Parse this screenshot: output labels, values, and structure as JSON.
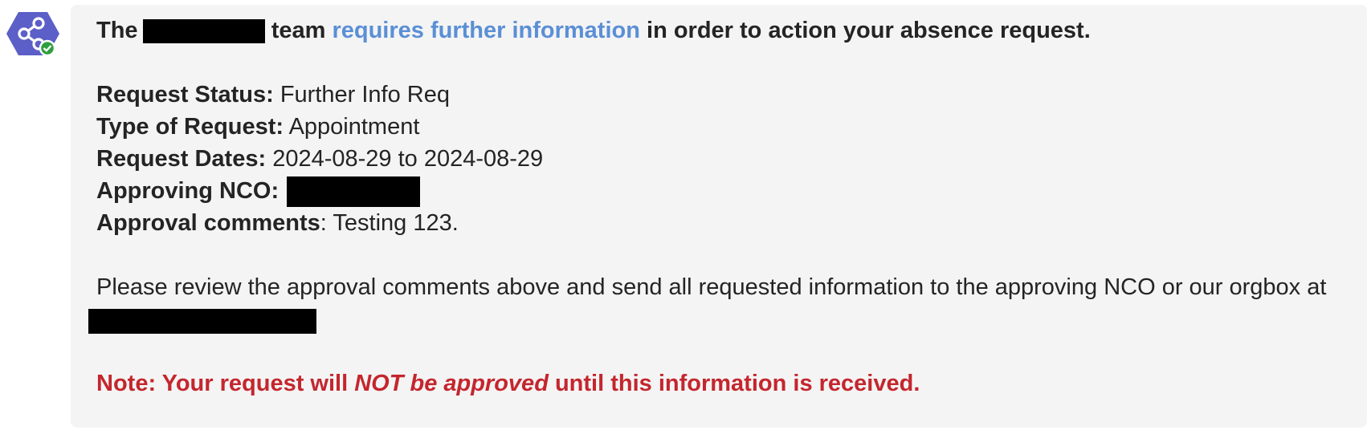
{
  "message": {
    "intro_before": "The",
    "intro_after": "team",
    "intro_link": "requires further information",
    "intro_end": "in order to action your absence request.",
    "fields": {
      "status_label": "Request Status:",
      "status_value": "Further Info Req",
      "type_label": "Type of Request:",
      "type_value": "Appointment",
      "dates_label": "Request Dates:",
      "dates_value": "2024-08-29 to 2024-08-29",
      "nco_label": "Approving NCO:",
      "comments_label": "Approval comments",
      "comments_value": ": Testing 123."
    },
    "instruction": "Please review the approval comments above and send all requested information to the approving NCO or our orgbox at",
    "note_start": "Note: Your request will",
    "note_emphasis": "NOT be approved",
    "note_end": "until this information is received."
  },
  "colors": {
    "link": "#5a8fd6",
    "note": "#c4262e",
    "avatar": "#5b5fc7",
    "status_check": "#2e9e3e"
  },
  "icons": {
    "avatar": "share-nodes-hexagon-icon",
    "badge": "checkmark-icon"
  }
}
